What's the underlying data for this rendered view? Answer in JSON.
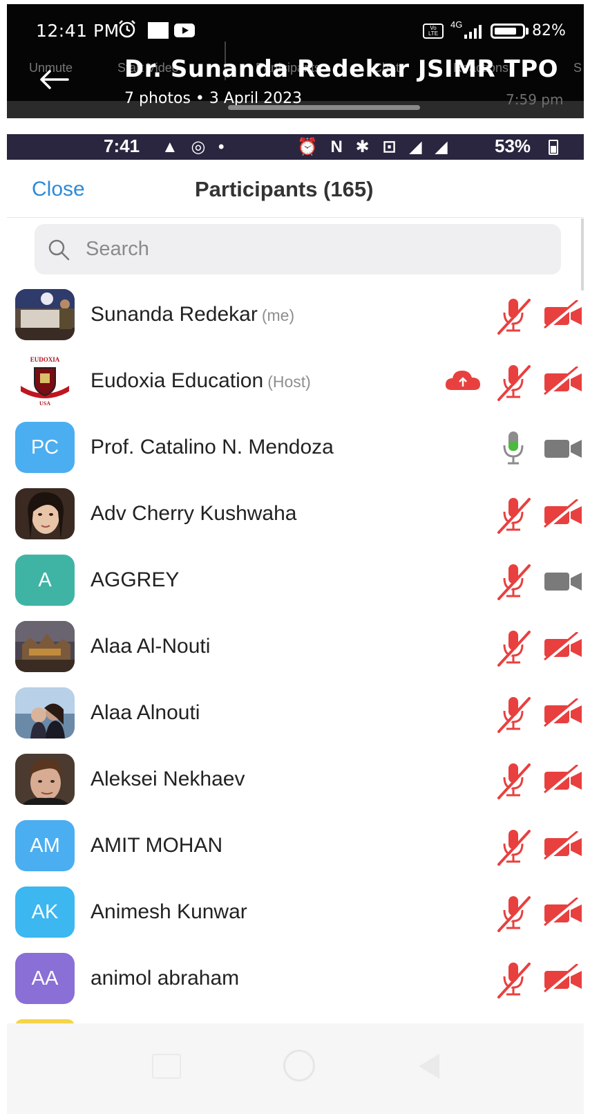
{
  "outer_status": {
    "time": "12:41 PM",
    "network": "4G",
    "battery_pct": "82%",
    "battery_level": 0.82
  },
  "ghost_toolbar": {
    "items": [
      "Unmute",
      "Start Video",
      "Participants",
      "Chat",
      "Reactions",
      "S"
    ]
  },
  "gallery": {
    "title": "Dr. Sunanda Redekar JSIMR TPO",
    "subtitle": "7 photos  •  3 April 2023",
    "timestamp": "7:59 pm"
  },
  "inner_status": {
    "time": "7:41",
    "icons": "▲ ◎ •",
    "right_icons": "⏰ N ✱ ⊡ ◢ ◢",
    "battery_pct": "53%"
  },
  "participants_header": {
    "close_label": "Close",
    "title": "Participants (165)"
  },
  "search": {
    "placeholder": "Search"
  },
  "colors": {
    "link_blue": "#2d8ad6",
    "muted_red": "#e8403f",
    "active_mic_green": "#4cba3c",
    "neutral_grey": "#7a7a7a"
  },
  "participants": [
    {
      "name": "Sunanda Redekar",
      "role": "(me)",
      "avatar_type": "photo",
      "avatar_icon": "studio-photo",
      "mic": "muted",
      "video": "off",
      "cloud": false
    },
    {
      "name": "Eudoxia Education",
      "role": "(Host)",
      "avatar_type": "logo",
      "avatar_icon": "eudoxia-crest-logo",
      "avatar_logo_text": "EUDOXIA",
      "avatar_logo_subtext": "USA",
      "mic": "muted",
      "video": "off",
      "cloud": true
    },
    {
      "name": "Prof. Catalino N. Mendoza",
      "role": "",
      "avatar_type": "initials",
      "initials": "PC",
      "avatar_color": "#4baef0",
      "mic": "on",
      "video": "on",
      "cloud": false
    },
    {
      "name": "Adv Cherry Kushwaha",
      "role": "",
      "avatar_type": "photo",
      "avatar_icon": "woman-portrait-photo",
      "mic": "muted",
      "video": "off",
      "cloud": false
    },
    {
      "name": "AGGREY",
      "role": "",
      "avatar_type": "initials",
      "initials": "A",
      "avatar_color": "#3fb4a5",
      "mic": "muted",
      "video": "on",
      "cloud": false
    },
    {
      "name": "Alaa Al-Nouti",
      "role": "",
      "avatar_type": "photo",
      "avatar_icon": "building-night-photo",
      "mic": "muted",
      "video": "off",
      "cloud": false
    },
    {
      "name": "Alaa Alnouti",
      "role": "",
      "avatar_type": "photo",
      "avatar_icon": "couple-sea-photo",
      "mic": "muted",
      "video": "off",
      "cloud": false
    },
    {
      "name": "Aleksei Nekhaev",
      "role": "",
      "avatar_type": "photo",
      "avatar_icon": "man-portrait-photo",
      "mic": "muted",
      "video": "off",
      "cloud": false
    },
    {
      "name": "AMIT MOHAN",
      "role": "",
      "avatar_type": "initials",
      "initials": "AM",
      "avatar_color": "#4baef0",
      "mic": "muted",
      "video": "off",
      "cloud": false
    },
    {
      "name": "Animesh Kunwar",
      "role": "",
      "avatar_type": "initials",
      "initials": "AK",
      "avatar_color": "#3cb7f0",
      "mic": "muted",
      "video": "off",
      "cloud": false
    },
    {
      "name": "animol abraham",
      "role": "",
      "avatar_type": "initials",
      "initials": "AA",
      "avatar_color": "#8a6fd6",
      "mic": "muted",
      "video": "off",
      "cloud": false
    }
  ]
}
